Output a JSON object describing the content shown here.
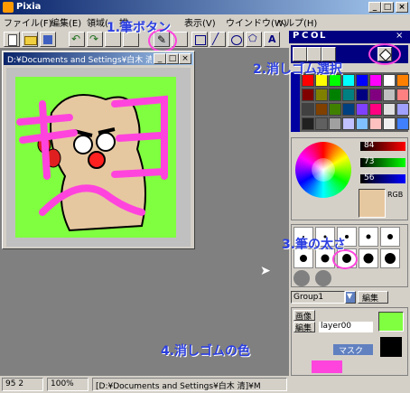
{
  "app": {
    "title": "Pixia"
  },
  "menu": [
    "ファイル(F)",
    "編集(E)",
    "領域(",
    "描",
    "表示(V)",
    "ウインドウ(W)",
    "ヘルプ(H)"
  ],
  "document": {
    "title": "D:¥Documents and Settings¥白木 清"
  },
  "palette_tabs": [
    "P",
    "C",
    "O",
    "L"
  ],
  "rgb": {
    "r": "84",
    "g": "73",
    "b": "56",
    "label": "RGB"
  },
  "brush_panel": {
    "group_value": "Group1",
    "edit_label": "編集"
  },
  "layer_panel": {
    "image_label": "画像",
    "edit_label": "編集",
    "layer_name": "layer00",
    "mask_label": "マスク"
  },
  "status": {
    "coords": "95 2",
    "zoom": "100%",
    "path": "[D:¥Documents and Settings¥白木 清]¥M"
  },
  "annotations": {
    "a1": "1.筆ボタン",
    "a2": "2.消しゴム選択",
    "a3": "3.筆の太さ",
    "a4": "4.消しゴムの色"
  },
  "colors": {
    "accent_annotation": "#2c3fe0",
    "highlight": "#ff44dd",
    "canvas_bg": "#80ff40"
  }
}
